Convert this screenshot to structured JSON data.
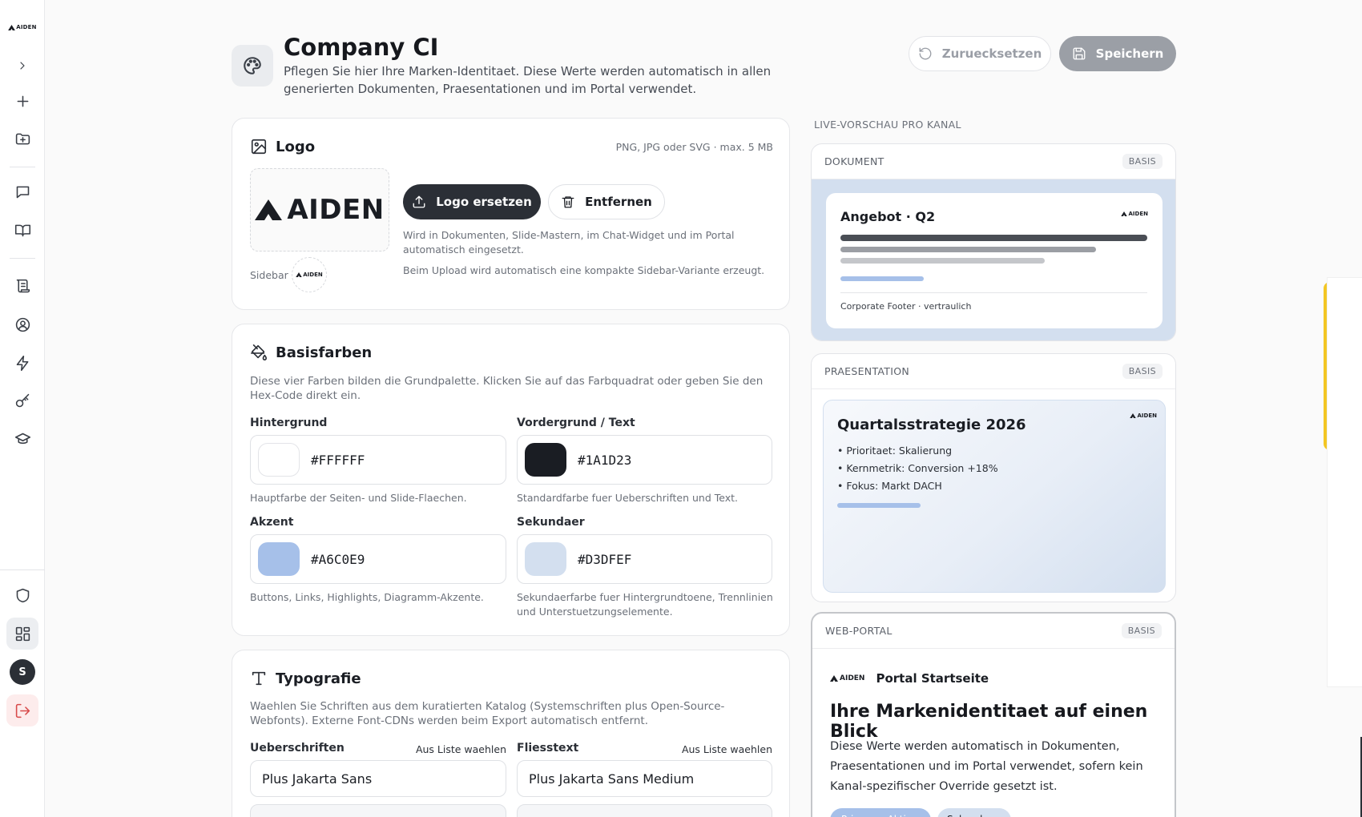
{
  "rail": {
    "brand_text": "AIDEN"
  },
  "header": {
    "title": "Company CI",
    "subtitle": "Pflegen Sie hier Ihre Marken-Identitaet. Diese Werte werden automatisch in allen generierten Dokumenten, Praesentationen und im Portal verwendet.",
    "reset_label": "Zuruecksetzen",
    "save_label": "Speichern"
  },
  "logo_card": {
    "title": "Logo",
    "formats": "PNG, JPG oder SVG · max. 5 MB",
    "logo_text": "AIDEN",
    "replace_label": "Logo ersetzen",
    "remove_label": "Entfernen",
    "hint1": "Wird in Dokumenten, Slide-Mastern, im Chat-Widget und im Portal automatisch eingesetzt.",
    "hint2": "Beim Upload wird automatisch eine kompakte Sidebar-Variante erzeugt.",
    "sidebar_label": "Sidebar",
    "sidebar_logo_text": "AIDEN"
  },
  "colors_card": {
    "title": "Basisfarben",
    "desc": "Diese vier Farben bilden die Grundpalette. Klicken Sie auf das Farbquadrat oder geben Sie den Hex-Code direkt ein.",
    "items": [
      {
        "label": "Hintergrund",
        "hex": "#FFFFFF",
        "help": "Hauptfarbe der Seiten- und Slide-Flaechen."
      },
      {
        "label": "Vordergrund / Text",
        "hex": "#1A1D23",
        "help": "Standardfarbe fuer Ueberschriften und Text."
      },
      {
        "label": "Akzent",
        "hex": "#A6C0E9",
        "help": "Buttons, Links, Highlights, Diagramm-Akzente."
      },
      {
        "label": "Sekundaer",
        "hex": "#D3DFEF",
        "help": "Sekundaerfarbe fuer Hintergrundtoene, Trennlinien und Unterstuetzungselemente."
      }
    ]
  },
  "typo_card": {
    "title": "Typografie",
    "desc": "Waehlen Sie Schriften aus dem kuratierten Katalog (Systemschriften plus Open-Source-Webfonts). Externe Font-CDNs werden beim Export automatisch entfernt.",
    "heading_label": "Ueberschriften",
    "heading_link": "Aus Liste waehlen",
    "heading_value": "Plus Jakarta Sans",
    "body_label": "Fliesstext",
    "body_link": "Aus Liste waehlen",
    "body_value": "Plus Jakarta Sans Medium"
  },
  "preview": {
    "label": "LIVE-VORSCHAU PRO KANAL",
    "doc": {
      "kind": "DOKUMENT",
      "badge": "BASIS",
      "title": "Angebot · Q2",
      "logo_text": "AIDEN",
      "footer": "Corporate Footer · vertraulich"
    },
    "pres": {
      "kind": "PRAESENTATION",
      "badge": "BASIS",
      "title": "Quartalsstrategie 2026",
      "logo_text": "AIDEN",
      "bullets": [
        "Prioritaet: Skalierung",
        "Kernmetrik: Conversion +18%",
        "Fokus: Markt DACH"
      ]
    },
    "web": {
      "kind": "WEB-PORTAL",
      "badge": "BASIS",
      "logo_text": "AIDEN",
      "nav_title": "Portal Startseite",
      "headline": "Ihre Markenidentitaet auf einen Blick",
      "body": "Diese Werte werden automatisch in Dokumenten, Praesentationen und im Portal verwendet, sofern kein Kanal-spezifischer Override gesetzt ist.",
      "primary_button": "Primaere Aktion",
      "secondary_button": "Sekundaer"
    }
  },
  "colors": {
    "accent": "#A6C0E9",
    "secondary": "#D3DFEF",
    "foreground": "#1A1D23",
    "background": "#FFFFFF"
  }
}
